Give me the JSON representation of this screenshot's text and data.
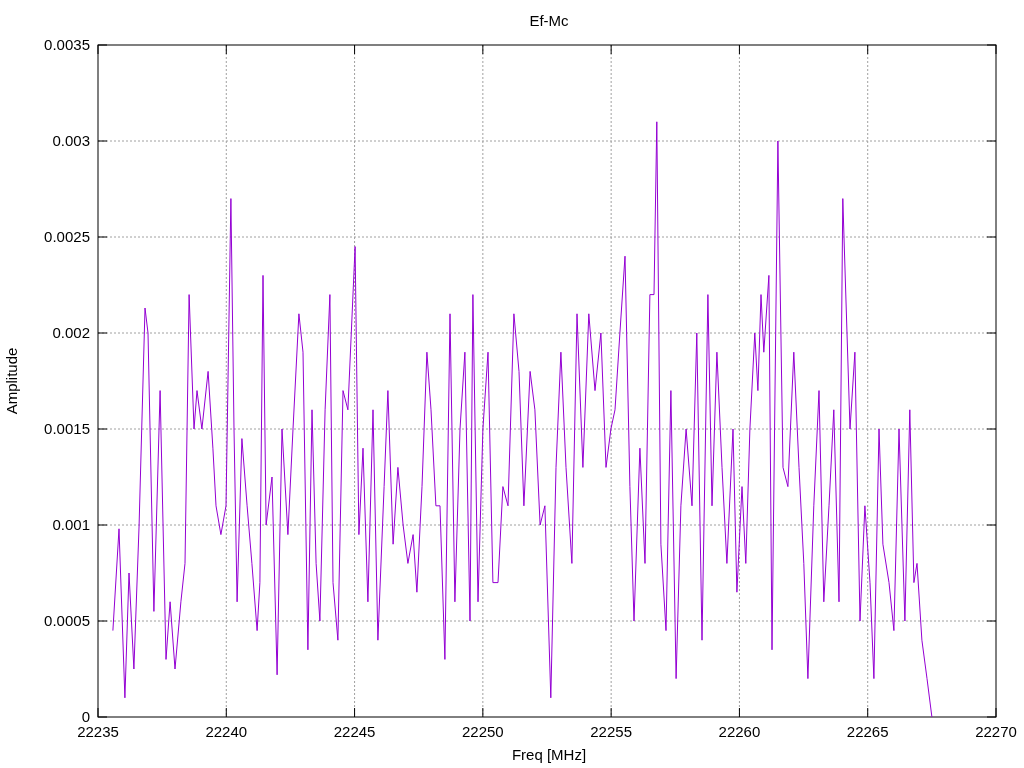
{
  "chart_data": {
    "type": "line",
    "title": "Ef-Mc",
    "xlabel": "Freq [MHz]",
    "ylabel": "Amplitude",
    "grid": true,
    "xlim": [
      22235,
      22270
    ],
    "ylim": [
      0,
      0.0035
    ],
    "xticks": [
      22235,
      22240,
      22245,
      22250,
      22255,
      22260,
      22265,
      22270
    ],
    "yticks": [
      0,
      0.0005,
      0.001,
      0.0015,
      0.002,
      0.0025,
      0.003,
      0.0035
    ],
    "x": [
      22235.58,
      22235.82,
      22236.05,
      22236.21,
      22236.4,
      22236.6,
      22236.83,
      22236.95,
      22237.18,
      22237.42,
      22237.65,
      22237.81,
      22238.0,
      22238.23,
      22238.39,
      22238.55,
      22238.74,
      22238.86,
      22239.05,
      22239.29,
      22239.48,
      22239.6,
      22239.79,
      22239.99,
      22240.18,
      22240.3,
      22240.42,
      22240.61,
      22240.81,
      22241.0,
      22241.2,
      22241.31,
      22241.43,
      22241.55,
      22241.78,
      22241.98,
      22242.17,
      22242.4,
      22242.6,
      22242.83,
      22242.99,
      22243.18,
      22243.34,
      22243.5,
      22243.65,
      22243.85,
      22244.04,
      22244.16,
      22244.35,
      22244.55,
      22244.74,
      22245.02,
      22245.17,
      22245.33,
      22245.52,
      22245.72,
      22245.91,
      22246.15,
      22246.3,
      22246.5,
      22246.69,
      22246.89,
      22247.08,
      22247.28,
      22247.43,
      22247.63,
      22247.82,
      22247.98,
      22248.17,
      22248.33,
      22248.52,
      22248.72,
      22248.91,
      22249.11,
      22249.3,
      22249.5,
      22249.61,
      22249.81,
      22250.0,
      22250.2,
      22250.39,
      22250.59,
      22250.78,
      22250.98,
      22251.21,
      22251.41,
      22251.6,
      22251.84,
      22252.03,
      22252.23,
      22252.42,
      22252.65,
      22252.85,
      22253.04,
      22253.24,
      22253.47,
      22253.67,
      22253.9,
      22254.13,
      22254.37,
      22254.6,
      22254.8,
      22254.99,
      22255.15,
      22255.34,
      22255.54,
      22255.73,
      22255.89,
      22256.12,
      22256.32,
      22256.51,
      22256.67,
      22256.78,
      22256.94,
      22257.14,
      22257.33,
      22257.53,
      22257.72,
      22257.92,
      22258.15,
      22258.34,
      22258.54,
      22258.77,
      22258.93,
      22259.12,
      22259.32,
      22259.51,
      22259.75,
      22259.9,
      22260.1,
      22260.25,
      22260.41,
      22260.6,
      22260.72,
      22260.84,
      22260.95,
      22261.15,
      22261.27,
      22261.5,
      22261.7,
      22261.89,
      22262.12,
      22262.32,
      22262.51,
      22262.67,
      22262.9,
      22263.1,
      22263.29,
      22263.49,
      22263.68,
      22263.88,
      22264.03,
      22264.31,
      22264.5,
      22264.7,
      22264.89,
      22265.09,
      22265.24,
      22265.44,
      22265.59,
      22265.83,
      22266.02,
      22266.22,
      22266.45,
      22266.64,
      22266.8,
      22266.92,
      22267.11,
      22267.31,
      22267.5
    ],
    "series": [
      {
        "color": "#9400d3",
        "values": [
          0.00045,
          0.00098,
          0.0001,
          0.00075,
          0.00025,
          0.001,
          0.00213,
          0.002,
          0.00055,
          0.0017,
          0.0003,
          0.0006,
          0.00025,
          0.0006,
          0.0008,
          0.0022,
          0.0015,
          0.0017,
          0.0015,
          0.0018,
          0.0014,
          0.0011,
          0.00095,
          0.0011,
          0.0027,
          0.0015,
          0.0006,
          0.00145,
          0.0011,
          0.0008,
          0.00045,
          0.0007,
          0.0023,
          0.001,
          0.00125,
          0.00022,
          0.0015,
          0.00095,
          0.0015,
          0.0021,
          0.0019,
          0.00035,
          0.0016,
          0.0008,
          0.0005,
          0.0016,
          0.0022,
          0.0007,
          0.0004,
          0.0017,
          0.0016,
          0.00245,
          0.00095,
          0.0014,
          0.0006,
          0.0016,
          0.0004,
          0.0012,
          0.0017,
          0.0009,
          0.0013,
          0.001,
          0.0008,
          0.00095,
          0.00065,
          0.0012,
          0.0019,
          0.0016,
          0.0011,
          0.0011,
          0.0003,
          0.0021,
          0.0006,
          0.0015,
          0.0019,
          0.0005,
          0.0022,
          0.0006,
          0.0015,
          0.0019,
          0.0007,
          0.0007,
          0.0012,
          0.0011,
          0.0021,
          0.0018,
          0.0011,
          0.0018,
          0.0016,
          0.001,
          0.0011,
          0.0001,
          0.0013,
          0.0019,
          0.0013,
          0.0008,
          0.0021,
          0.0013,
          0.0021,
          0.0017,
          0.002,
          0.0013,
          0.0015,
          0.0016,
          0.002,
          0.0024,
          0.0012,
          0.0005,
          0.0014,
          0.0008,
          0.0022,
          0.0022,
          0.0031,
          0.0009,
          0.00045,
          0.0017,
          0.0002,
          0.0011,
          0.0015,
          0.0011,
          0.002,
          0.0004,
          0.0022,
          0.0011,
          0.0019,
          0.0013,
          0.0008,
          0.0015,
          0.00065,
          0.0012,
          0.0008,
          0.0015,
          0.002,
          0.0017,
          0.0022,
          0.0019,
          0.0023,
          0.00035,
          0.003,
          0.0013,
          0.0012,
          0.0019,
          0.0013,
          0.0008,
          0.0002,
          0.0011,
          0.0017,
          0.0006,
          0.0011,
          0.0016,
          0.0006,
          0.0027,
          0.0015,
          0.0019,
          0.0005,
          0.0011,
          0.0007,
          0.0002,
          0.0015,
          0.0009,
          0.0007,
          0.00045,
          0.0015,
          0.0005,
          0.0016,
          0.0007,
          0.0008,
          0.0004,
          0.0002,
          0.0
        ]
      }
    ]
  }
}
